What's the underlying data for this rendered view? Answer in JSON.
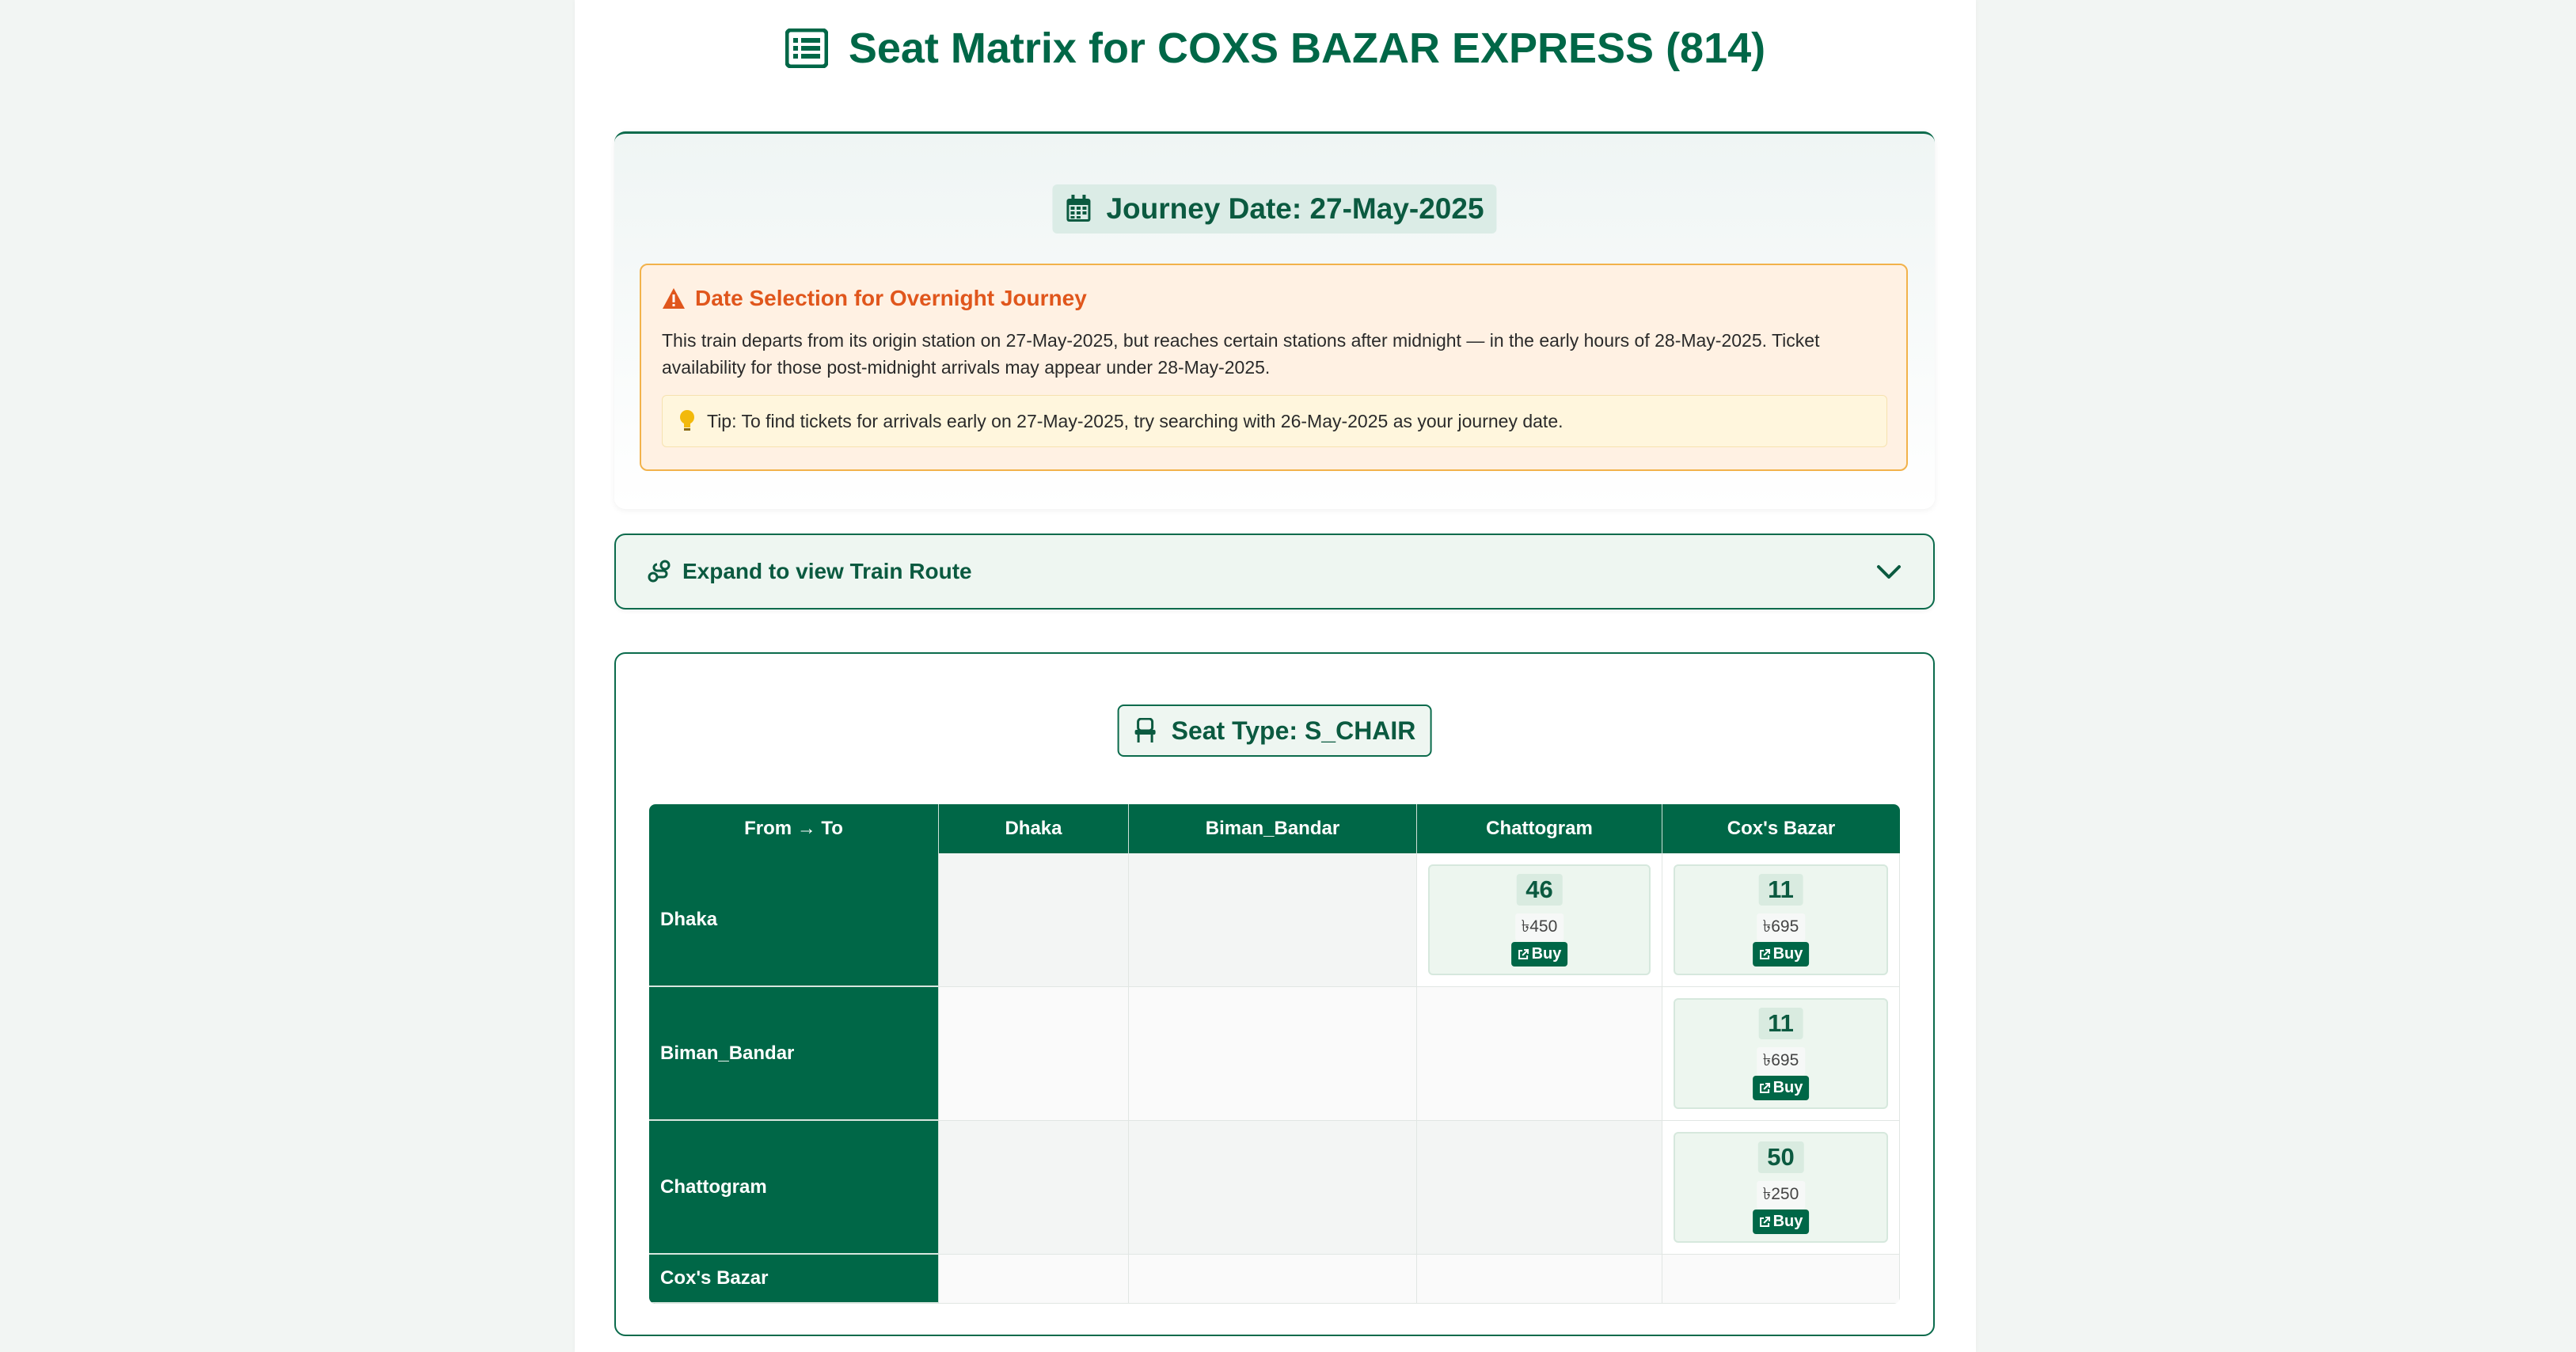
{
  "header": {
    "title": "Seat Matrix for COXS BAZAR EXPRESS (814)",
    "icon": "table-list-icon"
  },
  "journey": {
    "date_label": "Journey Date: 27-May-2025",
    "warning_title": "Date Selection for Overnight Journey",
    "warning_text": "This train departs from its origin station on 27-May-2025, but reaches certain stations after midnight — in the early hours of 28-May-2025. Ticket availability for those post-midnight arrivals may appear under 28-May-2025.",
    "tip_text": "Tip: To find tickets for arrivals early on 27-May-2025, try searching with 26-May-2025 as your journey date."
  },
  "route": {
    "expand_label": "Expand to view Train Route"
  },
  "matrix": {
    "seat_type_label": "Seat Type: S_CHAIR",
    "corner_header": "From → To",
    "columns": [
      "Dhaka",
      "Biman_Bandar",
      "Chattogram",
      "Cox's Bazar"
    ],
    "rows": [
      {
        "from": "Dhaka",
        "cells": [
          null,
          null,
          {
            "seats": "46",
            "fare": "৳450",
            "buy": "Buy"
          },
          {
            "seats": "11",
            "fare": "৳695",
            "buy": "Buy"
          }
        ]
      },
      {
        "from": "Biman_Bandar",
        "cells": [
          null,
          null,
          null,
          {
            "seats": "11",
            "fare": "৳695",
            "buy": "Buy"
          }
        ]
      },
      {
        "from": "Chattogram",
        "cells": [
          null,
          null,
          null,
          {
            "seats": "50",
            "fare": "৳250",
            "buy": "Buy"
          }
        ]
      },
      {
        "from": "Cox's Bazar",
        "cells": [
          null,
          null,
          null,
          null
        ]
      }
    ]
  },
  "colors": {
    "brand_green": "#006747",
    "warning_orange": "#e0561c",
    "warning_bg": "#fff1e3",
    "tip_bg": "#fff6dd"
  }
}
